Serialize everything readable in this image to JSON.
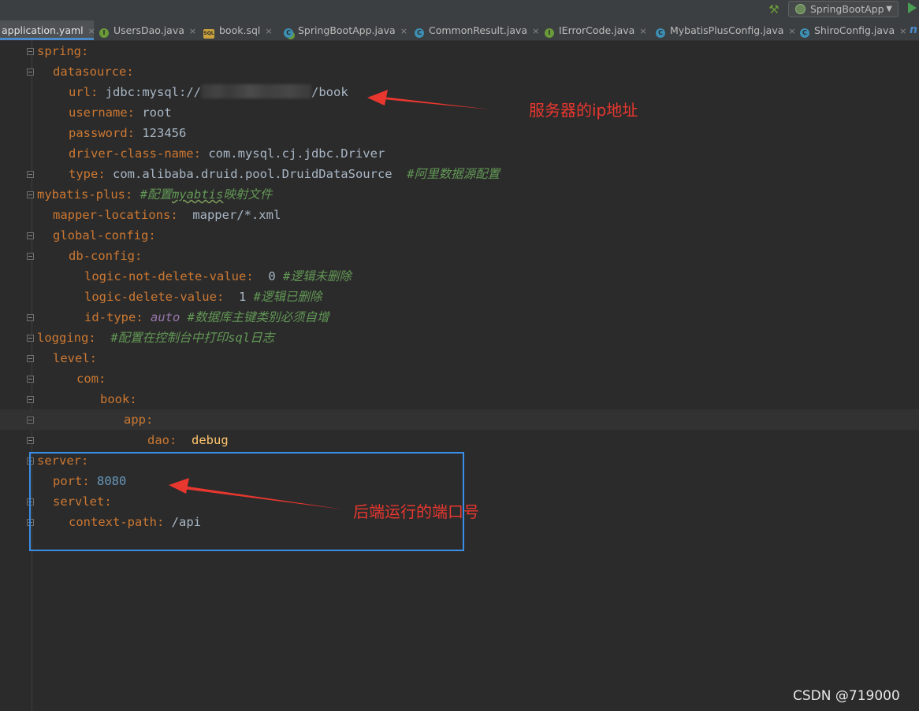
{
  "toolbar": {
    "build_icon": "hammer-icon",
    "run_config_label": "SpringBootApp",
    "run_icon": "play-icon"
  },
  "tabs": [
    {
      "label": "application.yaml",
      "icon": "yaml-file-icon",
      "active": true
    },
    {
      "label": "UsersDao.java",
      "icon": "interface-icon"
    },
    {
      "label": "book.sql",
      "icon": "sql-file-icon"
    },
    {
      "label": "SpringBootApp.java",
      "icon": "spring-boot-class-icon"
    },
    {
      "label": "CommonResult.java",
      "icon": "class-icon"
    },
    {
      "label": "IErrorCode.java",
      "icon": "interface-icon"
    },
    {
      "label": "MybatisPlusConfig.java",
      "icon": "class-icon"
    },
    {
      "label": "ShiroConfig.java",
      "icon": "class-icon"
    }
  ],
  "tab_close_glyph": "×",
  "tab_overflow_glyph": "n",
  "code": {
    "l1": {
      "key": "spring"
    },
    "l2": {
      "key": "datasource"
    },
    "l3": {
      "key": "url",
      "value_prefix": "jdbc:mysql://",
      "value_suffix": "/book"
    },
    "l4": {
      "key": "username",
      "value": "root"
    },
    "l5": {
      "key": "password",
      "value": "123456"
    },
    "l6": {
      "key": "driver-class-name",
      "value": "com.mysql.cj.jdbc.Driver"
    },
    "l7": {
      "key": "type",
      "value": "com.alibaba.druid.pool.DruidDataSource",
      "comment": "#阿里数据源配置"
    },
    "l8": {
      "key": "mybatis-plus",
      "comment_a": "#配置",
      "comment_b": "myabtis",
      "comment_c": "映射文件"
    },
    "l9": {
      "key": "mapper-locations",
      "value": "mapper/*.xml"
    },
    "l10": {
      "key": "global-config"
    },
    "l11": {
      "key": "db-config"
    },
    "l12": {
      "key": "logic-not-delete-value",
      "value": "0",
      "comment": "#逻辑未删除"
    },
    "l13": {
      "key": "logic-delete-value",
      "value": "1",
      "comment": "#逻辑已删除"
    },
    "l14": {
      "key": "id-type",
      "value": "auto",
      "comment": "#数据库主键类别必须自增"
    },
    "l15": {
      "key": "logging",
      "comment": "#配置在控制台中打印sql日志"
    },
    "l16": {
      "key": "level"
    },
    "l17": {
      "key": "com"
    },
    "l18": {
      "key": "book"
    },
    "l19": {
      "key": "app"
    },
    "l20": {
      "key": "dao",
      "value": "debug"
    },
    "l21": {
      "key": "server"
    },
    "l22": {
      "key": "port",
      "value": "8080"
    },
    "l23": {
      "key": "servlet"
    },
    "l24": {
      "key": "context-path",
      "value": "/api"
    }
  },
  "annotations": {
    "server_ip": "服务器的ip地址",
    "backend_port": "后端运行的端口号",
    "color": "#e8372f",
    "box_color": "#3a8ee6"
  },
  "watermark": "CSDN @719000"
}
